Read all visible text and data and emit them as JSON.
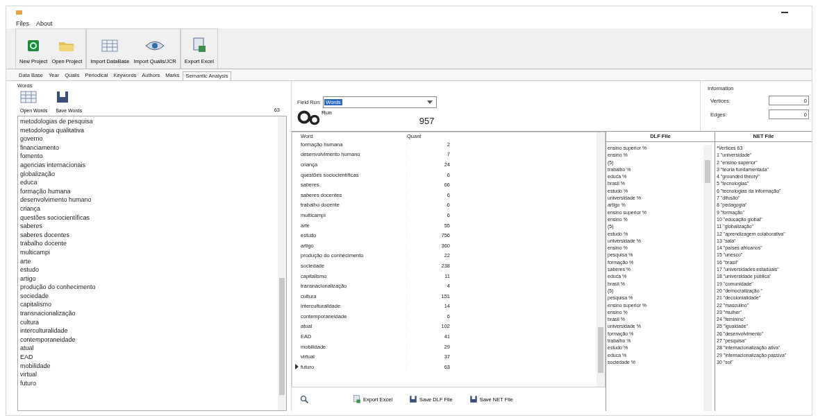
{
  "menu": [
    "Files",
    "About"
  ],
  "toolbar_groups": [
    {
      "buttons": [
        {
          "label": "New Project",
          "kind": "new"
        },
        {
          "label": "Open Project",
          "kind": "open"
        }
      ]
    },
    {
      "buttons": [
        {
          "label": "Import DataBase",
          "kind": "table"
        },
        {
          "label": "Import Qualis/JCR",
          "kind": "eye"
        }
      ]
    },
    {
      "buttons": [
        {
          "label": "Export Excel",
          "kind": "excel"
        }
      ]
    }
  ],
  "tabs": [
    {
      "label": "Data Base",
      "selected": false
    },
    {
      "label": "Year",
      "selected": false
    },
    {
      "label": "Qualis",
      "selected": false
    },
    {
      "label": "Periodical",
      "selected": false
    },
    {
      "label": "Keywords",
      "selected": false
    },
    {
      "label": "Authors",
      "selected": false
    },
    {
      "label": "Marks",
      "selected": false
    },
    {
      "label": "Semantic Analysis",
      "selected": true
    }
  ],
  "words_panel": {
    "title": "Words",
    "buttons": [
      {
        "label": "Open Words",
        "kind": "table"
      },
      {
        "label": "Save Words",
        "kind": "save"
      }
    ],
    "count": "63",
    "items": [
      "metodologias de pesquisa",
      "metodologia qualitativa",
      "governo",
      "financiamento",
      "fomento",
      "agencias internacionais",
      "globalização",
      "educa",
      "formação humana",
      "desenvolvimento humano",
      "criança",
      "questões sociocientíficas",
      "saberes",
      "saberes docentes",
      "trabalho docente",
      "multicampi",
      "arte",
      "estudo",
      "artigo",
      "produção do conhecimento",
      "sociedade",
      "capitalismo",
      "transnacionalização",
      "cultura",
      "interculturalidade",
      "contemporaneidade",
      "atual",
      "EAD",
      "mobilidade",
      "virtual",
      "futuro"
    ]
  },
  "run": {
    "field_label": "Field Run:",
    "field_value": "Words",
    "run_label": "Run",
    "total": "957"
  },
  "information": {
    "title": "Information",
    "vertices_label": "Vertices:",
    "vertices": "0",
    "edges_label": "Edges:",
    "edges": "0"
  },
  "table": {
    "columns": [
      "Word",
      "Quant"
    ],
    "rows": [
      {
        "word": "formação humana",
        "quant": "2",
        "current": false
      },
      {
        "word": "desenvolvimento humano",
        "quant": "7",
        "current": false
      },
      {
        "word": "criança",
        "quant": "24",
        "current": false
      },
      {
        "word": "questões sociocientíficas",
        "quant": "6",
        "current": false
      },
      {
        "word": "saberes",
        "quant": "66",
        "current": false
      },
      {
        "word": "saberes docentes",
        "quant": "6",
        "current": false
      },
      {
        "word": "trabalho docente",
        "quant": "6",
        "current": false
      },
      {
        "word": "multicampi",
        "quant": "6",
        "current": false
      },
      {
        "word": "arte",
        "quant": "55",
        "current": false
      },
      {
        "word": "estudo",
        "quant": "756",
        "current": false
      },
      {
        "word": "artigo",
        "quant": "360",
        "current": false
      },
      {
        "word": "produção do conhecimento",
        "quant": "22",
        "current": false
      },
      {
        "word": "sociedade",
        "quant": "238",
        "current": false
      },
      {
        "word": "capitalismo",
        "quant": "11",
        "current": false
      },
      {
        "word": "transnacionalização",
        "quant": "4",
        "current": false
      },
      {
        "word": "cultura",
        "quant": "151",
        "current": false
      },
      {
        "word": "interculturalidade",
        "quant": "14",
        "current": false
      },
      {
        "word": "contemporaneidade",
        "quant": "6",
        "current": false
      },
      {
        "word": "atual",
        "quant": "102",
        "current": false
      },
      {
        "word": "EAD",
        "quant": "41",
        "current": false
      },
      {
        "word": "mobilidade",
        "quant": "29",
        "current": false
      },
      {
        "word": "virtual",
        "quant": "37",
        "current": false
      },
      {
        "word": "futuro",
        "quant": "63",
        "current": true
      }
    ]
  },
  "dlf": {
    "title": "DLF File",
    "lines": [
      "ensino superior %",
      "ensino %",
      "(5)",
      "trabalho %",
      "educa %",
      "brasil %",
      "estudo %",
      "universidade %",
      "artigo %",
      "ensino superior %",
      "ensino %",
      "(5)",
      "estudo %",
      "universidade %",
      "ensino %",
      "pesquisa %",
      "formação %",
      "saberes %",
      "educa %",
      "brasil %",
      "(5)",
      "pesquisa %",
      "ensino superior %",
      "ensino %",
      "brasil %",
      "universidade %",
      "formação %",
      "trabalho %",
      "estudo %",
      "educa %",
      "sociedade %"
    ]
  },
  "net": {
    "title": "NET File",
    "lines": [
      "*Vertices 63",
      "1 \"universidade\"",
      "2 \"ensino superior\"",
      "3 \"teoria fundamentada\"",
      "4 \"grounded theory\"",
      "5 \"tecnologias\"",
      "6 \"tecnologias da informação\"",
      "7 \"difusão\"",
      "8 \"pedagogia\"",
      "9 \"formação\"",
      "10 \"educação global\"",
      "11 \"globalização\"",
      "12 \"aprendizagem colaborativa\"",
      "13 \"sala\"",
      "14 \"países africanos\"",
      "15 \"unesco\"",
      "16 \"brasil\"",
      "17 \"universidades estaduais\"",
      "18 \"universidade pública\"",
      "19 \"comunidade\"",
      "20 \"democratização \"",
      "21 \"decolonialidade\"",
      "22 \"masculino\"",
      "23 \"mulher\"",
      "24 \"feminino\"",
      "25 \"igualdade\"",
      "26 \"desenvolvimento\"",
      "27 \"pesquisa\"",
      "28 \"internacionalização ativa\"",
      "29 \"internacionalização passiva\"",
      "30 \"sol\""
    ]
  },
  "bottom_buttons": [
    {
      "label": "Export Excel",
      "kind": "excel"
    },
    {
      "label": "Save DLF File",
      "kind": "save"
    },
    {
      "label": "Save NET File",
      "kind": "save"
    }
  ]
}
